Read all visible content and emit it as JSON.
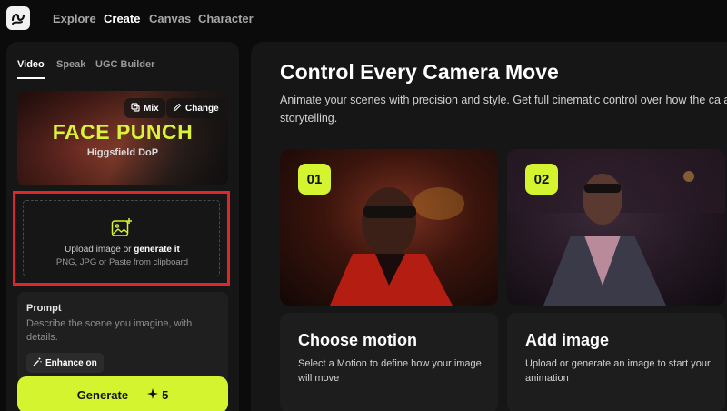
{
  "nav": {
    "logo": "higgsfield-logo-icon",
    "items": [
      {
        "label": "Explore",
        "active": false
      },
      {
        "label": "Create",
        "active": true
      },
      {
        "label": "Canvas",
        "active": false
      },
      {
        "label": "Character",
        "active": false
      }
    ]
  },
  "left": {
    "tabs": [
      "Video",
      "Speak",
      "UGC Builder"
    ],
    "hero": {
      "title": "FACE PUNCH",
      "subtitle": "Higgsfield DoP",
      "mix_label": "Mix",
      "change_label": "Change"
    },
    "upload": {
      "line1_prefix": "Upload image or",
      "line1_link": "generate it",
      "line2": "PNG, JPG or Paste from clipboard"
    },
    "prompt": {
      "label": "Prompt",
      "placeholder": "Describe the scene you imagine, with details.",
      "enhance_label": "Enhance on"
    },
    "generate": {
      "label": "Generate",
      "cost": "5"
    }
  },
  "main": {
    "title": "Control Every Camera Move",
    "description": "Animate your scenes with precision and style. Get full cinematic control over how the ca and storytelling.",
    "cards": [
      {
        "number": "01",
        "title": "Choose motion",
        "desc": "Select a Motion to define how your image will move"
      },
      {
        "number": "02",
        "title": "Add image",
        "desc": "Upload or generate an image to start your animation"
      }
    ]
  },
  "colors": {
    "accent": "#d4f430",
    "highlight_border": "#e0262c",
    "panel": "#161617",
    "background": "#0b0b0c"
  }
}
